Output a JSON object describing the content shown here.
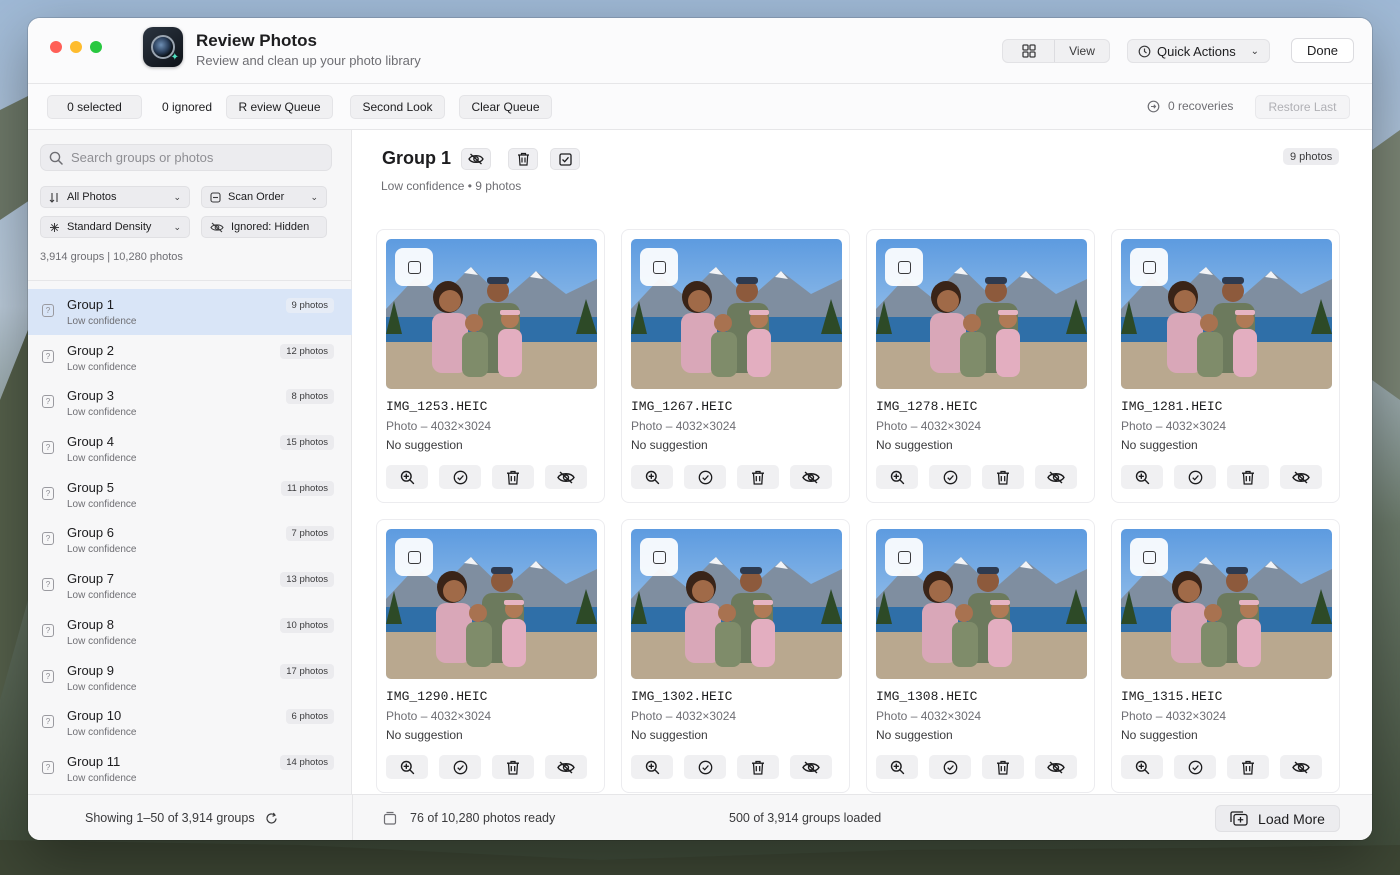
{
  "window": {
    "app_title": "Review Photos",
    "app_subtitle": "Review and clean up your photo library"
  },
  "header": {
    "view_label": "View",
    "quick_actions_label": "Quick Actions",
    "done_label": "Done"
  },
  "toolbar": {
    "selected": "0 selected",
    "ignored": "0 ignored",
    "review_queue": "R  eview Queue",
    "second_look": "Second Look",
    "clear_queue": "Clear Queue",
    "recoveries": "0 recoveries",
    "restore_last": "Restore Last"
  },
  "sidebar": {
    "search_placeholder": "Search groups or photos",
    "filters": {
      "source": "All Photos",
      "order": "Scan Order",
      "density": "Standard Density",
      "ignored": "Ignored: Hidden"
    },
    "stats": "3,914 groups | 10,280 photos",
    "groups": [
      {
        "name": "Group 1",
        "confidence": "Low confidence",
        "count": "9 photos"
      },
      {
        "name": "Group 2",
        "confidence": "Low confidence",
        "count": "12 photos"
      },
      {
        "name": "Group 3",
        "confidence": "Low confidence",
        "count": "8 photos"
      },
      {
        "name": "Group 4",
        "confidence": "Low confidence",
        "count": "15 photos"
      },
      {
        "name": "Group 5",
        "confidence": "Low confidence",
        "count": "11 photos"
      },
      {
        "name": "Group 6",
        "confidence": "Low confidence",
        "count": "7 photos"
      },
      {
        "name": "Group 7",
        "confidence": "Low confidence",
        "count": "13 photos"
      },
      {
        "name": "Group 8",
        "confidence": "Low confidence",
        "count": "10 photos"
      },
      {
        "name": "Group 9",
        "confidence": "Low confidence",
        "count": "17 photos"
      },
      {
        "name": "Group 10",
        "confidence": "Low confidence",
        "count": "6 photos"
      },
      {
        "name": "Group 11",
        "confidence": "Low confidence",
        "count": "14 photos"
      }
    ]
  },
  "main": {
    "group_title": "Group 1",
    "group_subtitle": "Low confidence • 9 photos",
    "photo_count_badge": "9 photos",
    "photos": [
      {
        "filename": "IMG_1253.HEIC",
        "meta": "Photo – 4032×3024",
        "suggestion": "No suggestion"
      },
      {
        "filename": "IMG_1267.HEIC",
        "meta": "Photo – 4032×3024",
        "suggestion": "No suggestion"
      },
      {
        "filename": "IMG_1278.HEIC",
        "meta": "Photo – 4032×3024",
        "suggestion": "No suggestion"
      },
      {
        "filename": "IMG_1281.HEIC",
        "meta": "Photo – 4032×3024",
        "suggestion": "No suggestion"
      },
      {
        "filename": "IMG_1290.HEIC",
        "meta": "Photo – 4032×3024",
        "suggestion": "No suggestion"
      },
      {
        "filename": "IMG_1302.HEIC",
        "meta": "Photo – 4032×3024",
        "suggestion": "No suggestion"
      },
      {
        "filename": "IMG_1308.HEIC",
        "meta": "Photo – 4032×3024",
        "suggestion": "No suggestion"
      },
      {
        "filename": "IMG_1315.HEIC",
        "meta": "Photo – 4032×3024",
        "suggestion": "No suggestion"
      }
    ]
  },
  "footer": {
    "showing": "Showing 1–50 of 3,914 groups",
    "ready": "76 of 10,280 photos ready",
    "loaded": "500 of 3,914 groups loaded",
    "load_more": "Load More"
  },
  "colors": {
    "accent_selected_row": "#d9e5f7",
    "close": "#ff5f57",
    "minimize": "#febc2e",
    "zoom": "#28c840"
  },
  "icons": [
    "search-icon",
    "grid-icon",
    "quick-actions-icon",
    "chevron-down-icon",
    "eye-slash-icon",
    "trash-icon",
    "checkbox-icon",
    "zoom-in-icon",
    "check-circle-icon",
    "refresh-icon",
    "stack-icon",
    "add-stack-icon",
    "recovery-icon",
    "question-icon"
  ]
}
